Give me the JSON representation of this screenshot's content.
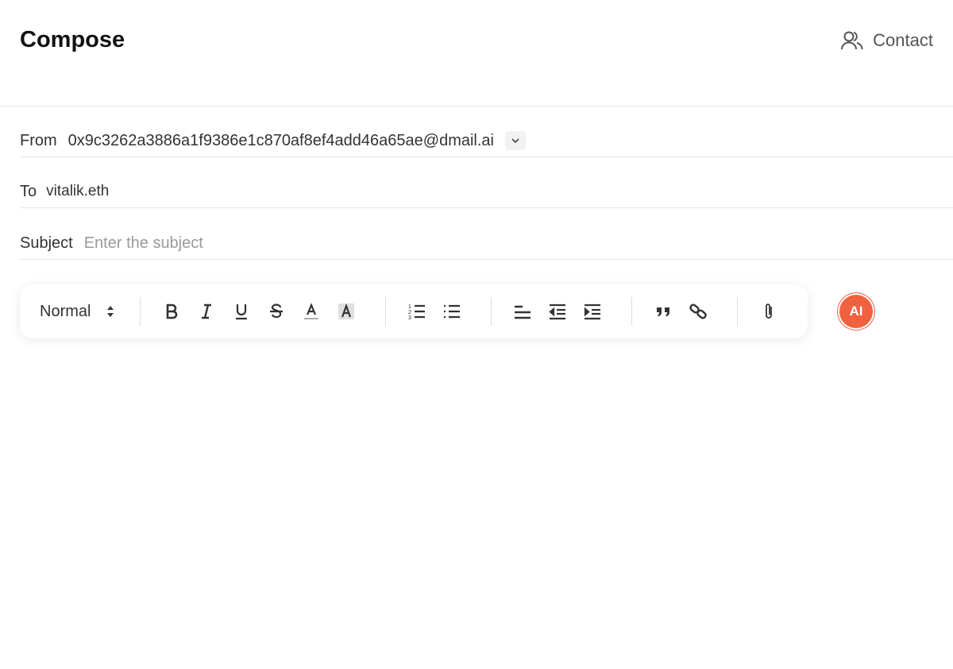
{
  "header": {
    "title": "Compose",
    "contact_label": "Contact",
    "contact_icon": "users-icon"
  },
  "form": {
    "from_label": "From",
    "from_value": "0x9c3262a3886a1f9386e1c870af8ef4add46a65ae@dmail.ai",
    "to_label": "To",
    "to_value": "vitalik.eth",
    "subject_label": "Subject",
    "subject_value": "",
    "subject_placeholder": "Enter the subject"
  },
  "toolbar": {
    "format_select": "Normal",
    "buttons": [
      "bold",
      "italic",
      "underline",
      "strikethrough",
      "text-color",
      "background-color",
      "ordered-list",
      "bullet-list",
      "align-left",
      "outdent",
      "indent",
      "blockquote",
      "link",
      "attachment"
    ]
  },
  "ai_button": {
    "label": "AI",
    "color": "#f0613f"
  }
}
